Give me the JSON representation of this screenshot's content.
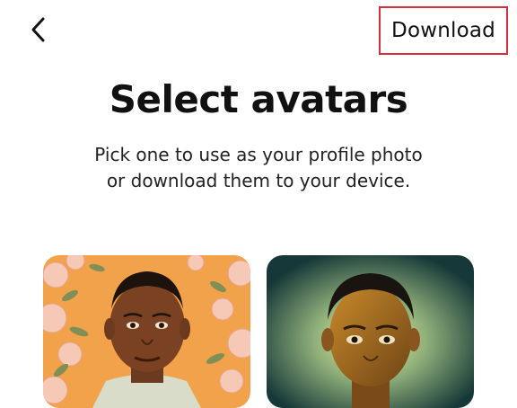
{
  "header": {
    "back_icon": "chevron-left-icon",
    "download_label": "Download",
    "download_highlight_color": "#d0313d"
  },
  "main": {
    "title": "Select avatars",
    "subtitle_line1": "Pick one to use as your profile photo",
    "subtitle_line2": "or download them to your device."
  },
  "avatars": [
    {
      "style": "floral-orange-portrait",
      "background": "#f0a04b"
    },
    {
      "style": "glowing-golden-portrait",
      "background": "#1b3a3a"
    }
  ]
}
